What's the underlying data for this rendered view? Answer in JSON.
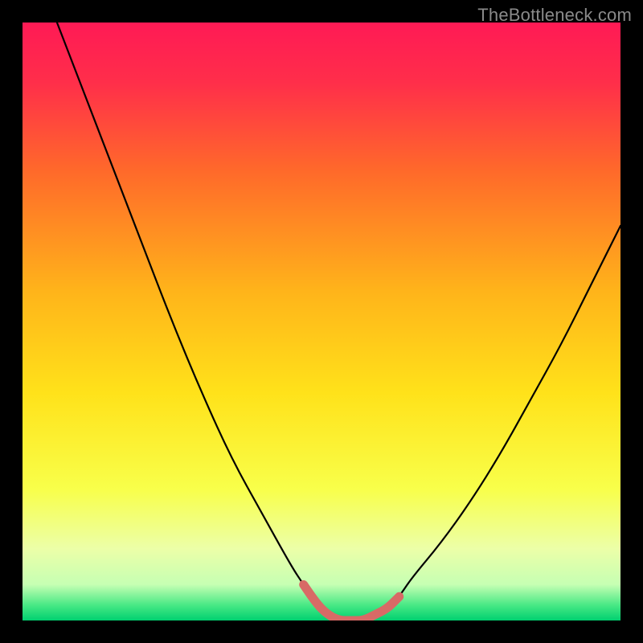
{
  "watermark": "TheBottleneck.com",
  "colors": {
    "frame": "#000000",
    "gradient_stops": [
      {
        "offset": 0.0,
        "color": "#ff1a55"
      },
      {
        "offset": 0.1,
        "color": "#ff2e4a"
      },
      {
        "offset": 0.25,
        "color": "#ff6a2a"
      },
      {
        "offset": 0.45,
        "color": "#ffb41a"
      },
      {
        "offset": 0.62,
        "color": "#ffe21a"
      },
      {
        "offset": 0.78,
        "color": "#f8ff4a"
      },
      {
        "offset": 0.88,
        "color": "#ecffa8"
      },
      {
        "offset": 0.94,
        "color": "#c6ffb3"
      },
      {
        "offset": 0.975,
        "color": "#46e884"
      },
      {
        "offset": 1.0,
        "color": "#00d070"
      }
    ],
    "curve_stroke": "#000000",
    "highlight_stroke": "#d86a66"
  },
  "chart_data": {
    "type": "line",
    "title": "",
    "xlabel": "",
    "ylabel": "",
    "xlim": [
      0,
      100
    ],
    "ylim": [
      0,
      100
    ],
    "x": [
      0,
      5,
      10,
      15,
      20,
      25,
      30,
      35,
      40,
      45,
      47,
      49,
      51,
      53,
      55,
      57,
      59,
      61,
      63,
      65,
      70,
      75,
      80,
      85,
      90,
      95,
      100
    ],
    "series": [
      {
        "name": "bottleneck-curve",
        "values": [
          115,
          102,
          89,
          76,
          63,
          50,
          38,
          27,
          18,
          9,
          6,
          3,
          1,
          0,
          0,
          0,
          1,
          2,
          4,
          7,
          13,
          20,
          28,
          37,
          46,
          56,
          66
        ]
      }
    ],
    "highlight_range_x": [
      47,
      63
    ],
    "annotations": []
  }
}
